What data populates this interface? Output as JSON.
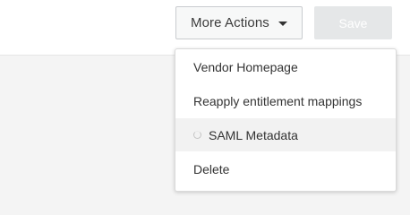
{
  "toolbar": {
    "more_actions_label": "More Actions",
    "save_label": "Save"
  },
  "dropdown": {
    "items": [
      {
        "label": "Vendor Homepage"
      },
      {
        "label": "Reapply entitlement mappings"
      },
      {
        "label": "SAML Metadata",
        "icon": "spinner-icon",
        "state": "hovered"
      },
      {
        "label": "Delete"
      }
    ]
  },
  "colors": {
    "page_background": "#f4f4f4",
    "button_border": "#c9cccf",
    "save_disabled": "#e5e7e8",
    "hover_background": "#f2f2f2"
  }
}
